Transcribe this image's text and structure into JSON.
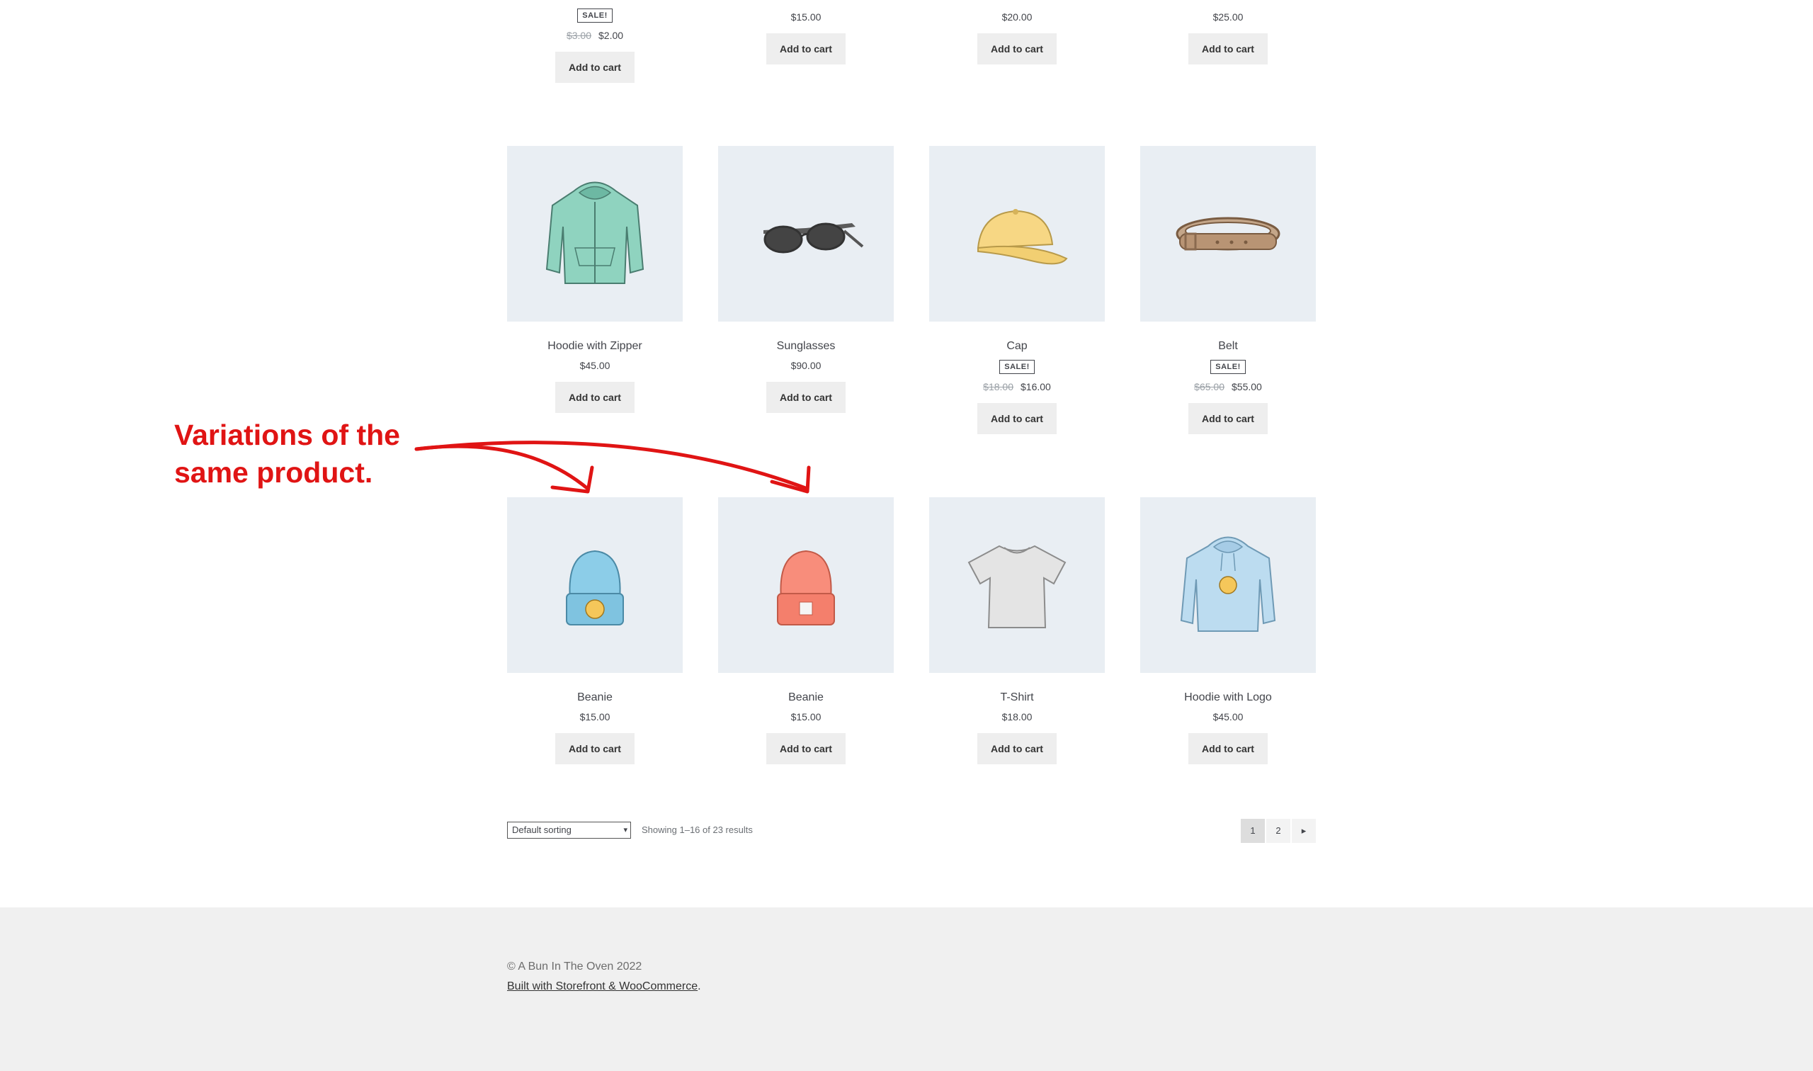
{
  "top_row": [
    {
      "sale_badge": "SALE!",
      "old_price": "$3.00",
      "price": "$2.00",
      "cart": "Add to cart"
    },
    {
      "price": "$15.00",
      "cart": "Add to cart"
    },
    {
      "price": "$20.00",
      "cart": "Add to cart"
    },
    {
      "price": "$25.00",
      "cart": "Add to cart"
    }
  ],
  "row2": [
    {
      "name": "Hoodie with Zipper",
      "price": "$45.00",
      "cart": "Add to cart",
      "icon": "hoodie-zipper-icon"
    },
    {
      "name": "Sunglasses",
      "price": "$90.00",
      "cart": "Add to cart",
      "icon": "sunglasses-icon"
    },
    {
      "name": "Cap",
      "sale_badge": "SALE!",
      "old_price": "$18.00",
      "price": "$16.00",
      "cart": "Add to cart",
      "icon": "cap-icon"
    },
    {
      "name": "Belt",
      "sale_badge": "SALE!",
      "old_price": "$65.00",
      "price": "$55.00",
      "cart": "Add to cart",
      "icon": "belt-icon"
    }
  ],
  "row3": [
    {
      "name": "Beanie",
      "price": "$15.00",
      "cart": "Add to cart",
      "icon": "blue-beanie-icon"
    },
    {
      "name": "Beanie",
      "price": "$15.00",
      "cart": "Add to cart",
      "icon": "orange-beanie-icon"
    },
    {
      "name": "T-Shirt",
      "price": "$18.00",
      "cart": "Add to cart",
      "icon": "tshirt-icon"
    },
    {
      "name": "Hoodie with Logo",
      "price": "$45.00",
      "cart": "Add to cart",
      "icon": "hoodie-logo-icon"
    }
  ],
  "annotation": {
    "line1": "Variations of the",
    "line2": "same product.",
    "color": "#e01414"
  },
  "toolbar": {
    "sort_label": "Default sorting",
    "result_count": "Showing 1–16 of 23 results"
  },
  "pagination": {
    "pages": [
      "1",
      "2"
    ],
    "current": "1",
    "next": "▸"
  },
  "footer": {
    "copyright": "© A Bun In The Oven 2022",
    "built_with": "Built with Storefront & WooCommerce",
    "built_suffix": "."
  }
}
